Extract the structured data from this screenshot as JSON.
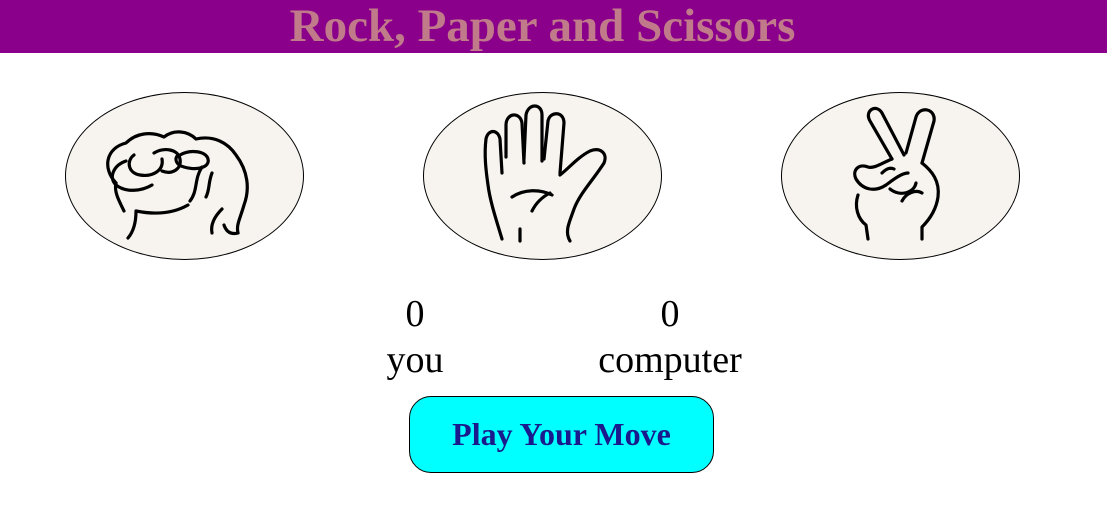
{
  "header": {
    "title": "Rock, Paper and Scissors"
  },
  "choices": [
    {
      "name": "rock",
      "icon": "fist-icon"
    },
    {
      "name": "paper",
      "icon": "open-hand-icon"
    },
    {
      "name": "scissors",
      "icon": "victory-hand-icon"
    }
  ],
  "scoreboard": {
    "user_score": "0",
    "user_label": "you",
    "computer_score": "0",
    "computer_label": "computer"
  },
  "play_button": {
    "label": "Play Your Move"
  },
  "colors": {
    "header_bg": "#8b008b",
    "title_text": "#c07a8a",
    "button_bg": "#00ffff",
    "button_text": "#1a1a8c",
    "choice_bg": "#f7f4ef"
  }
}
